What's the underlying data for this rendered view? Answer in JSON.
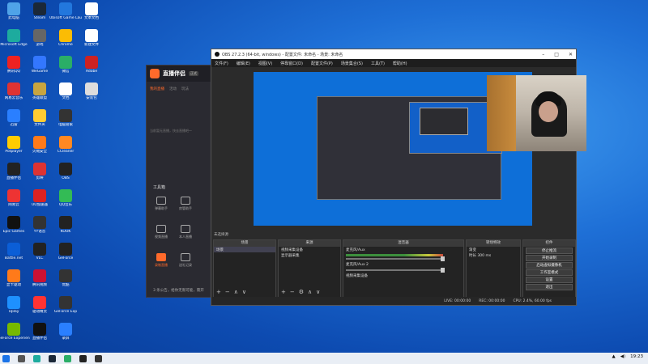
{
  "desktop": {
    "icons": [
      {
        "label": "此电脑",
        "color": "#4fa3e8"
      },
      {
        "label": "Steam",
        "color": "#1b2838"
      },
      {
        "label": "Ubisoft Game Launcher",
        "color": "#2277dd"
      },
      {
        "label": "文本文档",
        "color": "#ffffff"
      },
      {
        "label": "Microsoft Edge",
        "color": "#1dab9e"
      },
      {
        "label": "游戏",
        "color": "#666"
      },
      {
        "label": "Chrome",
        "color": "#fbbc04"
      },
      {
        "label": "新建文件",
        "color": "#ffffff"
      },
      {
        "label": "腾讯QQ",
        "color": "#e22"
      },
      {
        "label": "WeGame",
        "color": "#3377ff"
      },
      {
        "label": "微信",
        "color": "#2aae67"
      },
      {
        "label": "Adobe",
        "color": "#cc2222"
      },
      {
        "label": "网易云音乐",
        "color": "#d33"
      },
      {
        "label": "英雄联盟",
        "color": "#c8a540"
      },
      {
        "label": "文档",
        "color": "#fff"
      },
      {
        "label": "安装包",
        "color": "#ddd"
      },
      {
        "label": "迅雷",
        "color": "#2a7fff"
      },
      {
        "label": "文件夹",
        "color": "#ffcc33"
      },
      {
        "label": "电脑管家",
        "color": "#333"
      },
      {
        "label": "",
        "color": "transparent"
      },
      {
        "label": "Potplayer",
        "color": "#ffcc00"
      },
      {
        "label": "火绒安全",
        "color": "#ff7a1a"
      },
      {
        "label": "CCleaner",
        "color": "#ff8822"
      },
      {
        "label": "",
        "color": "transparent"
      },
      {
        "label": "直播伴侣",
        "color": "#222"
      },
      {
        "label": "剪映",
        "color": "#d33"
      },
      {
        "label": "OBS",
        "color": "#222"
      },
      {
        "label": "",
        "color": "transparent"
      },
      {
        "label": "网易云",
        "color": "#e33"
      },
      {
        "label": "UU加速器",
        "color": "#dd2222"
      },
      {
        "label": "QQ音乐",
        "color": "#33bb55"
      },
      {
        "label": "",
        "color": "transparent"
      },
      {
        "label": "Epic Games",
        "color": "#111"
      },
      {
        "label": "YY语音",
        "color": "#333"
      },
      {
        "label": "KOOK",
        "color": "#222"
      },
      {
        "label": "",
        "color": "transparent"
      },
      {
        "label": "Battle.net",
        "color": "#0b5ed7"
      },
      {
        "label": "VLC",
        "color": "#222"
      },
      {
        "label": "GeForce",
        "color": "#222"
      },
      {
        "label": "",
        "color": "transparent"
      },
      {
        "label": "显卡驱动",
        "color": "#ff7a1a"
      },
      {
        "label": "腾讯视频",
        "color": "#c13"
      },
      {
        "label": "优酷",
        "color": "#333"
      },
      {
        "label": "",
        "color": "transparent"
      },
      {
        "label": "Uplay",
        "color": "#1e90ff"
      },
      {
        "label": "驱动精灵",
        "color": "#ff3333"
      },
      {
        "label": "GeForce Exp",
        "color": "#333"
      },
      {
        "label": "",
        "color": "transparent"
      },
      {
        "label": "GeForce Experience",
        "color": "#76b900"
      },
      {
        "label": "直播伴侣",
        "color": "#111"
      },
      {
        "label": "录屏",
        "color": "#2a7fff"
      },
      {
        "label": "",
        "color": "transparent"
      }
    ]
  },
  "stream_app": {
    "brand": "直播伴侣",
    "version": "正式",
    "tabs": [
      "我的直播",
      "活动",
      "玩法"
    ],
    "empty_text": "当前暂无直播，快去直播吧～",
    "tools_title": "工具箱",
    "tools": [
      "弹幕助手",
      "房管助手",
      "",
      "视频直播",
      "本人直播",
      "",
      "录制直播",
      "送礼记录",
      ""
    ],
    "footer": "3 条公告，给你无限可能，需开"
  },
  "obs": {
    "title": "OBS 27.2.3 (64-bit, windows) - 配置文件: 未命名 - 场景: 未命名",
    "menu": [
      "文件(F)",
      "编辑(E)",
      "视图(V)",
      "停靠窗口(D)",
      "配置文件(P)",
      "场景集合(S)",
      "工具(T)",
      "帮助(H)"
    ],
    "no_source": "未选择源",
    "scenes": {
      "title": "场景",
      "items": [
        "场景"
      ]
    },
    "sources": {
      "title": "来源",
      "items": [
        "视频采集设备",
        "显示器采集"
      ]
    },
    "mixer": {
      "title": "混音器",
      "channels": [
        {
          "name": "麦克风/Aux",
          "db": "0.0 dB"
        },
        {
          "name": "麦克风/Aux 2",
          "db": "-inf dB"
        },
        {
          "name": "视频采集设备",
          "db": "-inf dB"
        }
      ]
    },
    "transitions": {
      "title": "转场特效",
      "type": "渐变",
      "duration_label": "时长",
      "duration": "300 ms"
    },
    "controls": {
      "title": "控件",
      "buttons": [
        "停止推流",
        "开始录制",
        "启动虚拟摄像机",
        "工作室模式",
        "设置",
        "退出"
      ]
    },
    "status": {
      "live": "LIVE: 00:00:00",
      "rec": "REC: 00:00:00",
      "cpu": "CPU: 2.4%, 60.00 fps"
    }
  },
  "taskbar": {
    "time": "19:23",
    "apps": [
      {
        "name": "start",
        "color": "#1a73e8"
      },
      {
        "name": "search",
        "color": "#555"
      },
      {
        "name": "edge",
        "color": "#1dab9e"
      },
      {
        "name": "steam",
        "color": "#1b2838"
      },
      {
        "name": "wechat",
        "color": "#2aae67"
      },
      {
        "name": "live-assistant",
        "color": "#222"
      },
      {
        "name": "obs",
        "color": "#333"
      }
    ]
  }
}
